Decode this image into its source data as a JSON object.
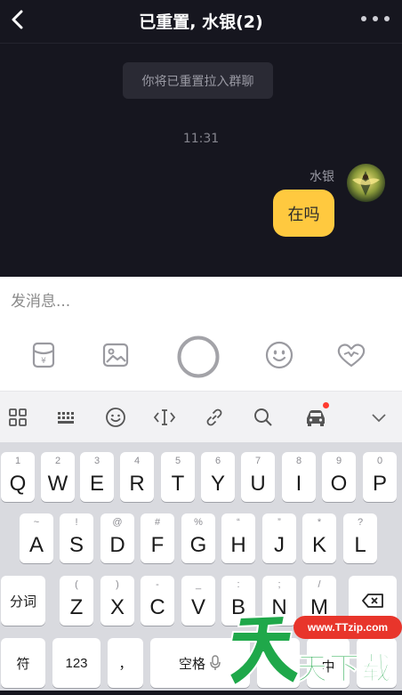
{
  "header": {
    "title": "已重置, 水银(2)"
  },
  "chat": {
    "system_message": "你将已重置拉入群聊",
    "time": "11:31",
    "sender": "水银",
    "message": "在吗"
  },
  "composer": {
    "placeholder": "发消息..."
  },
  "keyboard": {
    "row1": [
      {
        "main": "Q",
        "hint": "1"
      },
      {
        "main": "W",
        "hint": "2"
      },
      {
        "main": "E",
        "hint": "3"
      },
      {
        "main": "R",
        "hint": "4"
      },
      {
        "main": "T",
        "hint": "5"
      },
      {
        "main": "Y",
        "hint": "6"
      },
      {
        "main": "U",
        "hint": "7"
      },
      {
        "main": "I",
        "hint": "8"
      },
      {
        "main": "O",
        "hint": "9"
      },
      {
        "main": "P",
        "hint": "0"
      }
    ],
    "row2": [
      {
        "main": "A",
        "hint": "~"
      },
      {
        "main": "S",
        "hint": "!"
      },
      {
        "main": "D",
        "hint": "@"
      },
      {
        "main": "F",
        "hint": "#"
      },
      {
        "main": "G",
        "hint": "%"
      },
      {
        "main": "H",
        "hint": "“"
      },
      {
        "main": "J",
        "hint": "”"
      },
      {
        "main": "K",
        "hint": "*"
      },
      {
        "main": "L",
        "hint": "?"
      }
    ],
    "row3": [
      {
        "main": "Z",
        "hint": "("
      },
      {
        "main": "X",
        "hint": ")"
      },
      {
        "main": "C",
        "hint": "-"
      },
      {
        "main": "V",
        "hint": "_"
      },
      {
        "main": "B",
        "hint": ":"
      },
      {
        "main": "N",
        "hint": ";"
      },
      {
        "main": "M",
        "hint": "/"
      }
    ],
    "fenci_label": "分词",
    "fu_label": "符",
    "num_label": "123",
    "comma_label": "，",
    "space_label": "空格",
    "zhong_label": "中"
  },
  "watermark": {
    "site": "www.TTzip.com",
    "big_char": "天",
    "text": "天下载"
  },
  "colors": {
    "bubble": "#ffc93f",
    "chat_bg": "#16161f",
    "accent_dot": "#ff3b30",
    "watermark_green": "#1fa84a",
    "watermark_red": "#e8352b"
  }
}
